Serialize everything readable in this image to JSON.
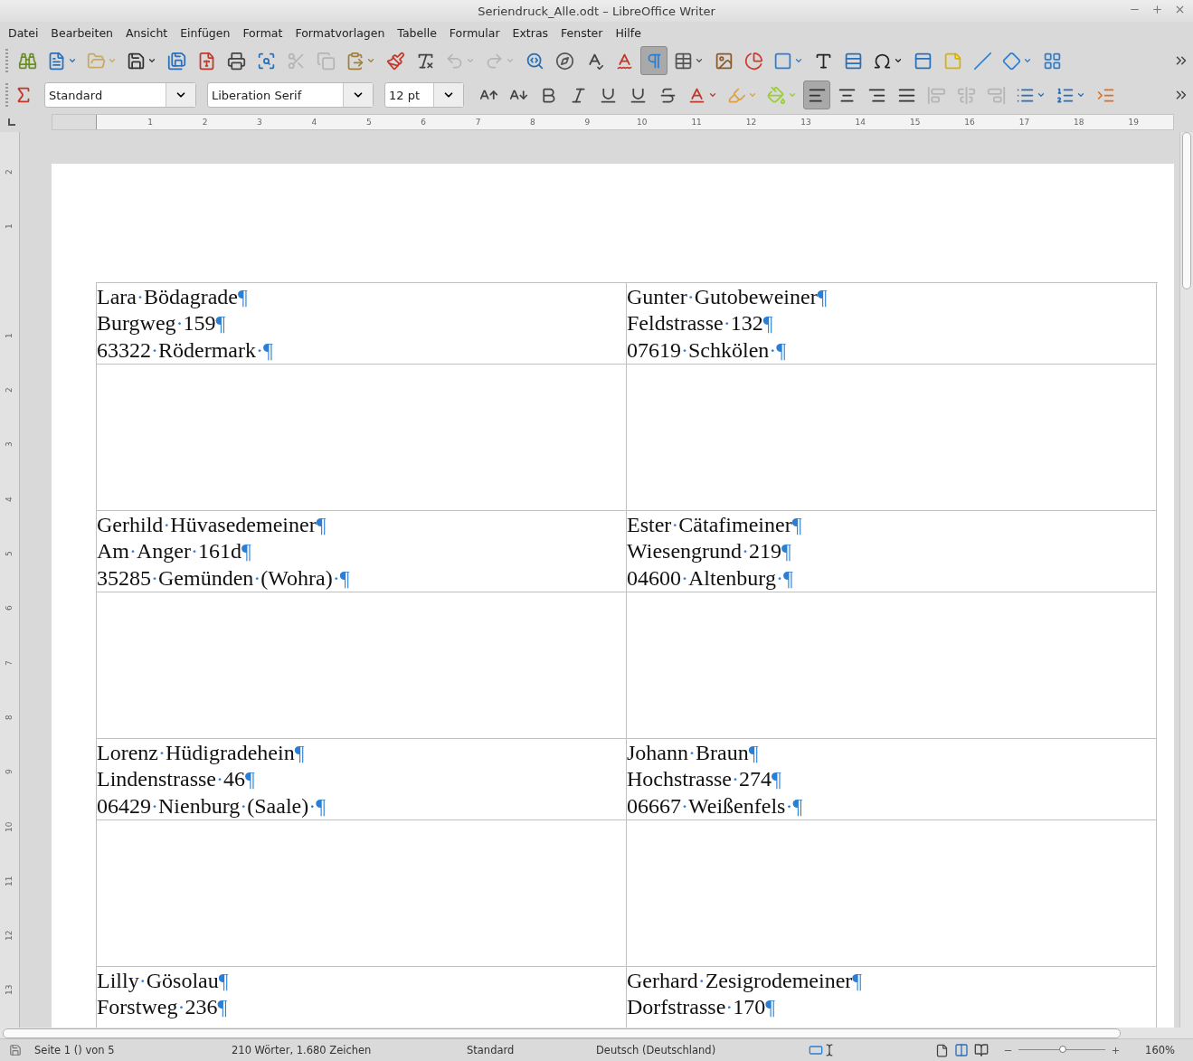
{
  "window": {
    "title": "Seriendruck_Alle.odt – LibreOffice Writer"
  },
  "menu": [
    "Datei",
    "Bearbeiten",
    "Ansicht",
    "Einfügen",
    "Format",
    "Formatvorlagen",
    "Tabelle",
    "Formular",
    "Extras",
    "Fenster",
    "Hilfe"
  ],
  "toolbar_standard": [
    {
      "selected": false,
      "disabled": false,
      "has_menu": false
    },
    {
      "selected": false,
      "disabled": false,
      "has_menu": true
    },
    {
      "selected": false,
      "disabled": false,
      "has_menu": true
    },
    {
      "selected": false,
      "disabled": false,
      "has_menu": true
    },
    {
      "selected": false,
      "disabled": false,
      "has_menu": false
    },
    {
      "selected": false,
      "disabled": false,
      "has_menu": false
    },
    {
      "selected": false,
      "disabled": false,
      "has_menu": false
    },
    {
      "selected": false,
      "disabled": false,
      "has_menu": false
    },
    {
      "selected": false,
      "disabled": true,
      "has_menu": false
    },
    {
      "selected": false,
      "disabled": true,
      "has_menu": false
    },
    {
      "selected": false,
      "disabled": false,
      "has_menu": true
    },
    {
      "selected": false,
      "disabled": false,
      "has_menu": false
    },
    {
      "selected": false,
      "disabled": false,
      "has_menu": false
    },
    {
      "selected": false,
      "disabled": true,
      "has_menu": true
    },
    {
      "selected": false,
      "disabled": true,
      "has_menu": true
    },
    {
      "selected": false,
      "disabled": false,
      "has_menu": false
    },
    {
      "selected": false,
      "disabled": false,
      "has_menu": false
    },
    {
      "selected": false,
      "disabled": false,
      "has_menu": false
    },
    {
      "selected": false,
      "disabled": false,
      "has_menu": false
    },
    {
      "selected": true,
      "disabled": false,
      "has_menu": false
    },
    {
      "selected": false,
      "disabled": false,
      "has_menu": true
    },
    {
      "selected": false,
      "disabled": false,
      "has_menu": false
    },
    {
      "selected": false,
      "disabled": false,
      "has_menu": false
    },
    {
      "selected": false,
      "disabled": false,
      "has_menu": true
    },
    {
      "selected": false,
      "disabled": false,
      "has_menu": false
    },
    {
      "selected": false,
      "disabled": false,
      "has_menu": false
    },
    {
      "selected": false,
      "disabled": false,
      "has_menu": true
    },
    {
      "selected": false,
      "disabled": false,
      "has_menu": false
    },
    {
      "selected": false,
      "disabled": false,
      "has_menu": false
    },
    {
      "selected": false,
      "disabled": false,
      "has_menu": false
    },
    {
      "selected": false,
      "disabled": false,
      "has_menu": true
    },
    {
      "selected": false,
      "disabled": false,
      "has_menu": false
    }
  ],
  "formatting": {
    "paragraph_style": "Standard",
    "font_name": "Liberation Serif",
    "font_size": "12 pt"
  },
  "toolbar_formatting": [
    {
      "selected": false,
      "disabled": false,
      "has_menu": false
    },
    {
      "selected": false,
      "disabled": false,
      "has_menu": false
    },
    {
      "selected": false,
      "disabled": false,
      "has_menu": false
    },
    {
      "selected": false,
      "disabled": false,
      "has_menu": false
    },
    {
      "selected": false,
      "disabled": false,
      "has_menu": false
    },
    {
      "selected": false,
      "disabled": false,
      "has_menu": false
    },
    {
      "selected": false,
      "disabled": false,
      "has_menu": false
    },
    {
      "selected": false,
      "disabled": false,
      "has_menu": true
    },
    {
      "selected": false,
      "disabled": false,
      "has_menu": true
    },
    {
      "selected": false,
      "disabled": false,
      "has_menu": true
    },
    {
      "selected": true,
      "disabled": false,
      "has_menu": false
    },
    {
      "selected": false,
      "disabled": false,
      "has_menu": false
    },
    {
      "selected": false,
      "disabled": false,
      "has_menu": false
    },
    {
      "selected": false,
      "disabled": false,
      "has_menu": false
    },
    {
      "selected": false,
      "disabled": true,
      "has_menu": false
    },
    {
      "selected": false,
      "disabled": true,
      "has_menu": false
    },
    {
      "selected": false,
      "disabled": true,
      "has_menu": false
    },
    {
      "selected": false,
      "disabled": false,
      "has_menu": true
    },
    {
      "selected": false,
      "disabled": false,
      "has_menu": true
    },
    {
      "selected": false,
      "disabled": false,
      "has_menu": false
    }
  ],
  "ruler": {
    "labels": [
      "1",
      "2",
      "3",
      "4",
      "5",
      "6",
      "7",
      "8",
      "9",
      "10",
      "11",
      "12",
      "13",
      "14",
      "15",
      "16",
      "17",
      "18",
      "19"
    ]
  },
  "vertical_ruler": {
    "top_margin_labels": [
      "2",
      "1"
    ],
    "labels": [
      "1",
      "2",
      "3",
      "4",
      "5",
      "6",
      "7",
      "8",
      "9",
      "10",
      "11",
      "12",
      "13"
    ]
  },
  "table": {
    "rows": [
      {
        "cells": [
          {
            "lines": [
              "Lara·Bödagrade¶",
              "Burgweg·159¶",
              "63322·Rödermark·¶"
            ]
          },
          {
            "lines": [
              "Gunter·Gutobeweiner¶",
              "Feldstrasse·132¶",
              "07619·Schkölen·¶"
            ]
          }
        ]
      },
      {
        "cells": [
          {
            "lines": [
              "Gerhild·Hüvasedemeiner¶",
              "Am·Anger·161d¶",
              "35285·Gemünden·(Wohra)·¶"
            ]
          },
          {
            "lines": [
              "Ester·Cätafimeiner¶",
              "Wiesengrund·219¶",
              "04600·Altenburg·¶"
            ]
          }
        ]
      },
      {
        "cells": [
          {
            "lines": [
              "Lorenz·Hüdigradehein¶",
              "Lindenstrasse·46¶",
              "06429·Nienburg·(Saale)·¶"
            ]
          },
          {
            "lines": [
              "Johann·Braun¶",
              "Hochstrasse·274¶",
              "06667·Weißenfels·¶"
            ]
          }
        ]
      },
      {
        "cells": [
          {
            "lines": [
              "Lilly·Gösolau¶",
              "Forstweg·236¶"
            ]
          },
          {
            "lines": [
              "Gerhard·Zesigrodemeiner¶",
              "Dorfstrasse·170¶"
            ]
          }
        ]
      }
    ]
  },
  "status_bar": {
    "page": "Seite 1 () von 5",
    "word_count": "210 Wörter, 1.680 Zeichen",
    "page_style": "Standard",
    "language": "Deutsch (Deutschland)",
    "zoom": {
      "level": 0.52,
      "reading": "160%"
    }
  }
}
